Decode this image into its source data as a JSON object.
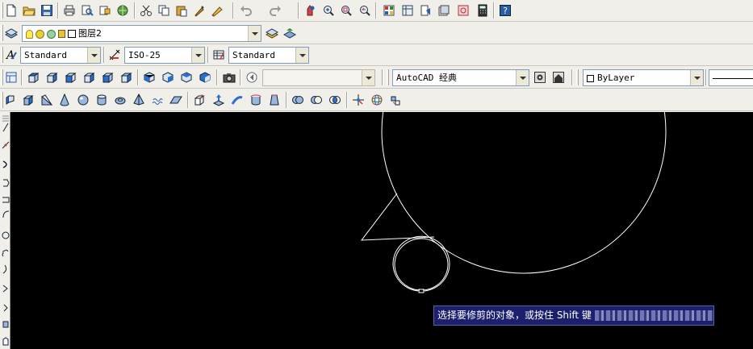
{
  "toolbar_row1": {
    "icons": [
      "new-icon",
      "open-icon",
      "save-icon",
      "print-icon",
      "plot-preview-icon",
      "publish-icon",
      "3d-dwf-icon",
      "cut-icon",
      "copy-icon",
      "paste-icon",
      "match-properties-icon",
      "block-editor-icon",
      "undo-icon",
      "redo-icon",
      "pan-icon",
      "zoom-realtime-icon",
      "zoom-window-icon",
      "zoom-previous-icon",
      "properties-icon",
      "design-center-icon",
      "tool-palettes-icon",
      "sheet-set-icon",
      "markup-icon",
      "calculator-icon",
      "help-icon"
    ]
  },
  "layers": {
    "layer_name": "图层2"
  },
  "styles": {
    "text_style": "Standard",
    "dim_style": "ISO-25",
    "table_style": "Standard"
  },
  "workspace": {
    "named_view": "",
    "workspace_name": "AutoCAD 经典",
    "color_control": "ByLayer"
  },
  "command_tooltip": {
    "text": "选择要修剪的对象，或按住 Shift 键"
  },
  "colors": {
    "toolbar_bg": "#f0efe9",
    "canvas_bg": "#000000",
    "entity_stroke": "#ffffff",
    "tooltip_bg": "#1b1f6c"
  }
}
